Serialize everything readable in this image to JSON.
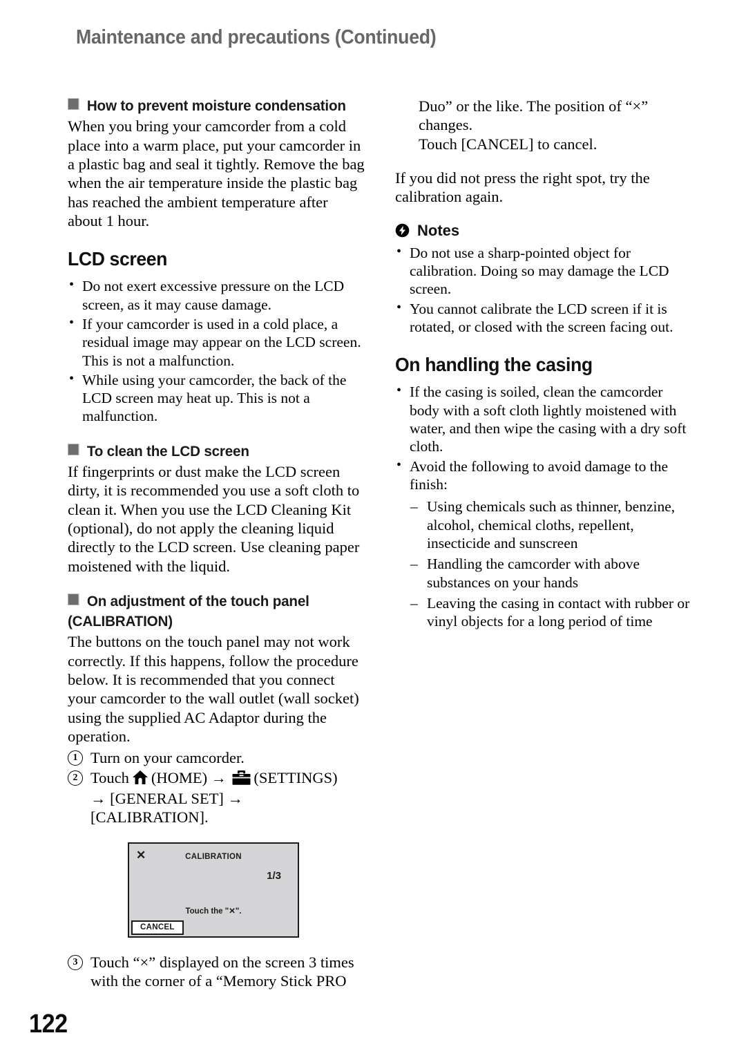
{
  "page": {
    "running_head": "Maintenance and precautions (Continued)",
    "folio": "122"
  },
  "left_column": {
    "section_moisture": {
      "heading": "How to prevent moisture condensation",
      "body": "When you bring your camcorder from a cold place into a warm place, put your camcorder in a plastic bag and seal it tightly. Remove the bag when the air temperature inside the plastic bag has reached the ambient temperature after about 1 hour."
    },
    "section_lcd": {
      "heading": "LCD screen",
      "bullets": [
        "Do not exert excessive pressure on the LCD screen, as it may cause damage.",
        "If your camcorder is used in a cold place, a residual image may appear on the LCD screen. This is not a malfunction.",
        "While using your camcorder, the back of the LCD screen may heat up. This is not a malfunction."
      ]
    },
    "section_clean": {
      "heading": "To clean the LCD screen",
      "body": "If fingerprints or dust make the LCD screen dirty, it is recommended you use a soft cloth to clean it. When you use the LCD Cleaning Kit (optional), do not apply the cleaning liquid directly to the LCD screen. Use cleaning paper moistened with the liquid."
    },
    "section_calibration": {
      "heading_line1": "On adjustment of the touch panel",
      "heading_line2": "(CALIBRATION)",
      "body": "The buttons on the touch panel may not work correctly. If this happens, follow the procedure below. It is recommended that you connect your camcorder to the wall outlet (wall socket) using the supplied AC Adaptor during the operation.",
      "steps": [
        {
          "number": "1",
          "text": "Turn on your camcorder."
        },
        {
          "number": "2",
          "text_before_home": "Touch",
          "home_label": "(HOME)",
          "arrow": "→",
          "settings_label": "(SETTINGS)",
          "text_after": "→ [GENERAL SET] → [CALIBRATION]."
        },
        {
          "number": "3",
          "text": "Touch “×” displayed on the screen 3 times with the corner of a “Memory Stick PRO"
        }
      ],
      "figure": {
        "close_glyph": "✕",
        "title": "CALIBRATION",
        "page_indicator": "1/3",
        "instruction": "Touch the \"✕\".",
        "cancel_label": "CANCEL",
        "background_color": "#d4d4d7",
        "border_color": "#1b1b1b"
      }
    }
  },
  "right_column": {
    "continuation": {
      "line1": "Duo” or the like. The position of “×” changes.",
      "line2": "Touch [CANCEL] to cancel.",
      "paragraph": "If you did not press the right spot, try the calibration again."
    },
    "notes": {
      "heading": "Notes",
      "icon": "lightning-bolt-icon",
      "bullets": [
        "Do not use a sharp-pointed object for calibration. Doing so may damage the LCD screen.",
        "You cannot calibrate the LCD screen if it is rotated, or closed with the screen facing out."
      ]
    },
    "section_casing": {
      "heading": "On handling the casing",
      "bullets": [
        "If the casing is soiled, clean the camcorder body with a soft cloth lightly moistened with water, and then wipe the casing with a dry soft cloth.",
        "Avoid the following to avoid damage to the finish:"
      ],
      "dashes": [
        "Using chemicals such as thinner, benzine, alcohol, chemical cloths, repellent, insecticide and sunscreen",
        "Handling the camcorder with above substances on your hands",
        "Leaving the casing in contact with rubber or vinyl objects for a long period of time"
      ]
    }
  },
  "colors": {
    "running_head": "#676767",
    "square_bullet": "#6d6d6d",
    "body_text": "#000000"
  }
}
